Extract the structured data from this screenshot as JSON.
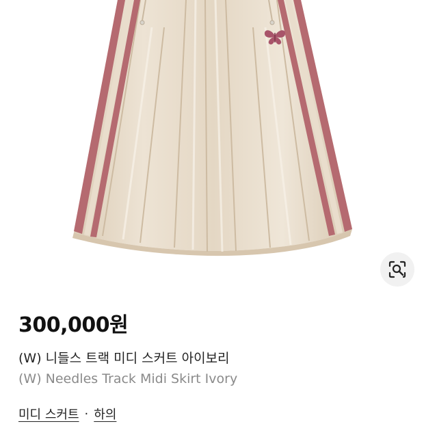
{
  "product": {
    "image_subject": "ivory pleated track midi skirt with pink side stripes and butterfly logo",
    "price": "300,000원",
    "title_ko": "(W) 니들스 트랙 미디 스커트 아이보리",
    "title_en": "(W) Needles Track Midi Skirt Ivory"
  },
  "visual_search": {
    "icon": "camera-search-icon"
  },
  "breadcrumb": {
    "items": [
      "미디 스커트",
      "하의"
    ],
    "separator": "·"
  },
  "colors": {
    "skirt": "#e8dccb",
    "stripe": "#b56a70",
    "logo": "#a8546a",
    "price": "#111111",
    "subtitle": "#8a8a8a"
  }
}
